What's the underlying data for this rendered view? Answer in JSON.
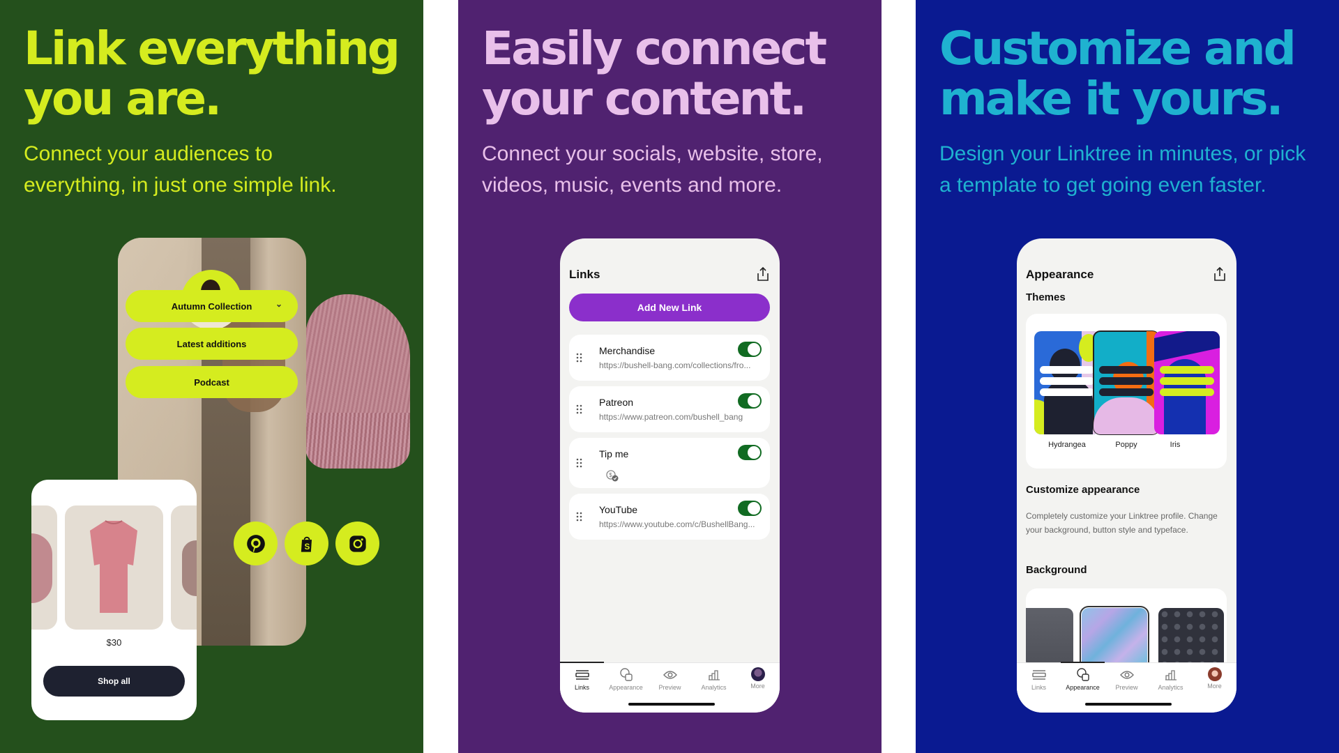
{
  "panels": [
    {
      "headline": "Link everything\nyou are.",
      "subtitle": "Connect your audiences to\neverything, in just one simple link.",
      "background_color": "#24501c",
      "text_color": "#d5ec1f"
    },
    {
      "headline": "Easily connect\nyour content.",
      "subtitle": "Connect your socials, website, store,\nvideos, music, events and more.",
      "background_color": "#502270",
      "text_color": "#e9c0ea"
    },
    {
      "headline": "Customize and\nmake it yours.",
      "subtitle": "Design your Linktree in minutes, or pick\na template to get going even faster.",
      "background_color": "#0a1a91",
      "text_color": "#1fb2d0"
    }
  ],
  "profile_preview": {
    "buttons": [
      {
        "label": "Autumn Collection",
        "icon": "chevron-down-icon"
      },
      {
        "label": "Latest additions"
      },
      {
        "label": "Podcast"
      }
    ],
    "socials": [
      "pinterest-icon",
      "shopify-icon",
      "instagram-icon"
    ],
    "shop": {
      "price": "$30",
      "button_label": "Shop all"
    },
    "accent_color": "#d5ec1f"
  },
  "links_screen": {
    "title": "Links",
    "add_button_label": "Add New Link",
    "accent_color": "#8b2fcb",
    "links": [
      {
        "name": "Merchandise",
        "url": "https://bushell-bang.com/collections/fro...",
        "enabled": true
      },
      {
        "name": "Patreon",
        "url": "https://www.patreon.com/bushell_bang",
        "enabled": true
      },
      {
        "name": "Tip me",
        "url": "",
        "icon": "tip-dollar-icon",
        "enabled": true
      },
      {
        "name": "YouTube",
        "url": "https://www.youtube.com/c/BushellBang...",
        "enabled": true
      }
    ],
    "tabs": [
      {
        "label": "Links",
        "icon": "links-icon",
        "active": true
      },
      {
        "label": "Appearance",
        "icon": "appearance-icon",
        "active": false
      },
      {
        "label": "Preview",
        "icon": "eye-icon",
        "active": false
      },
      {
        "label": "Analytics",
        "icon": "analytics-icon",
        "active": false
      },
      {
        "label": "More",
        "icon": "avatar",
        "active": false
      }
    ]
  },
  "appearance_screen": {
    "title": "Appearance",
    "themes_heading": "Themes",
    "themes": [
      {
        "name": "Hydrangea",
        "selected": false
      },
      {
        "name": "Poppy",
        "selected": true
      },
      {
        "name": "Iris",
        "selected": false
      }
    ],
    "customize_heading": "Customize appearance",
    "customize_description": "Completely customize your Linktree profile. Change your background, button style and typeface.",
    "background_heading": "Background",
    "backgrounds": [
      {
        "name": "solid-gray",
        "selected": false
      },
      {
        "name": "marble",
        "selected": true
      },
      {
        "name": "polka-dots",
        "selected": false
      }
    ],
    "tabs": [
      {
        "label": "Links",
        "icon": "links-icon",
        "active": false
      },
      {
        "label": "Appearance",
        "icon": "appearance-icon",
        "active": true
      },
      {
        "label": "Preview",
        "icon": "eye-icon",
        "active": false
      },
      {
        "label": "Analytics",
        "icon": "analytics-icon",
        "active": false
      },
      {
        "label": "More",
        "icon": "avatar",
        "active": false
      }
    ]
  }
}
